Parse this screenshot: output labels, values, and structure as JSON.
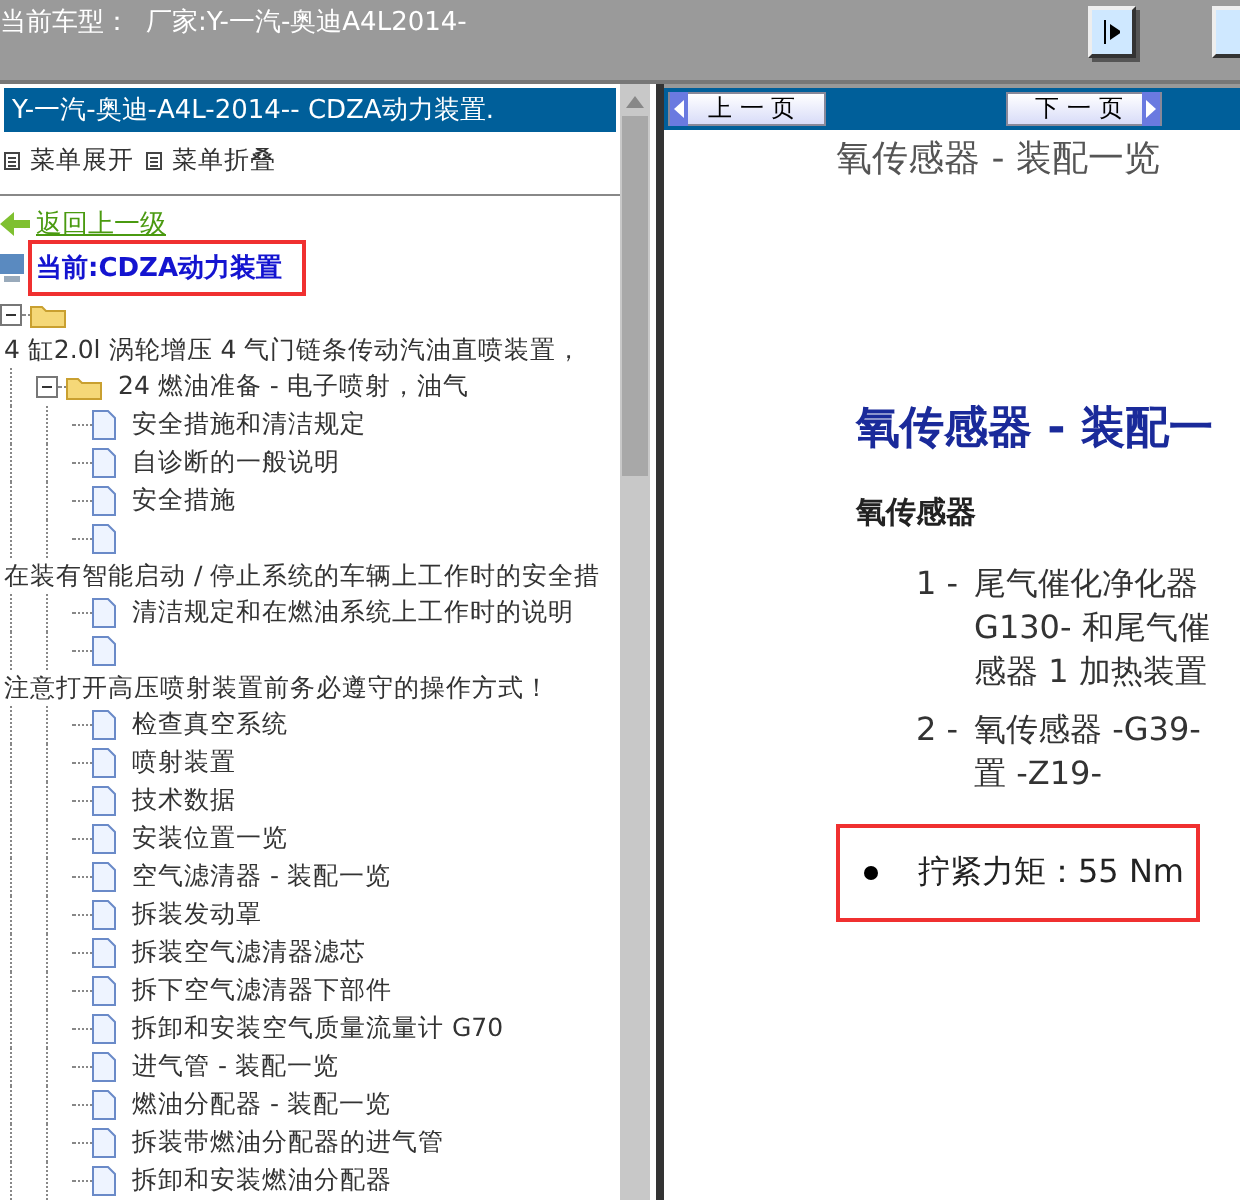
{
  "top_bar": {
    "label": "当前车型：",
    "vehicle": "厂家:Y-一汽-奥迪A4L2014-"
  },
  "left_pane": {
    "title": "Y-一汽-奥迪-A4L-2014-- CDZA动力装置.",
    "menu_actions": [
      "菜单展开",
      "菜单折叠"
    ],
    "back_link": "返回上一级",
    "current": "当前:CDZA动力装置",
    "tree": [
      {
        "kind": "folder",
        "expanded": true,
        "children": [
          {
            "kind": "note",
            "label": "4 缸2.0l 涡轮增压 4 气门链条传动汽油直喷装置，"
          },
          {
            "kind": "folder",
            "expanded": true,
            "label": "24 燃油准备 - 电子喷射，油气",
            "children": [
              {
                "kind": "doc",
                "label": "安全措施和清洁规定"
              },
              {
                "kind": "doc",
                "label": "自诊断的一般说明"
              },
              {
                "kind": "doc",
                "label": "安全措施"
              },
              {
                "kind": "doc"
              },
              {
                "kind": "note",
                "label": "在装有智能启动 / 停止系统的车辆上工作时的安全措"
              },
              {
                "kind": "doc",
                "label": "清洁规定和在燃油系统上工作时的说明"
              },
              {
                "kind": "doc"
              },
              {
                "kind": "note",
                "label": "注意打开高压喷射装置前务必遵守的操作方式！"
              },
              {
                "kind": "doc",
                "label": "检查真空系统"
              },
              {
                "kind": "doc",
                "label": "喷射装置"
              },
              {
                "kind": "doc",
                "label": "技术数据"
              },
              {
                "kind": "doc",
                "label": "安装位置一览"
              },
              {
                "kind": "doc",
                "label": "空气滤清器 - 装配一览"
              },
              {
                "kind": "doc",
                "label": "拆装发动罩"
              },
              {
                "kind": "doc",
                "label": "拆装空气滤清器滤芯"
              },
              {
                "kind": "doc",
                "label": "拆下空气滤清器下部件"
              },
              {
                "kind": "doc",
                "label": "拆卸和安装空气质量流量计 G70"
              },
              {
                "kind": "doc",
                "label": "进气管 - 装配一览"
              },
              {
                "kind": "doc",
                "label": "燃油分配器 - 装配一览"
              },
              {
                "kind": "doc",
                "label": "拆装带燃油分配器的进气管"
              },
              {
                "kind": "doc",
                "label": "拆卸和安装燃油分配器"
              }
            ]
          }
        ]
      }
    ]
  },
  "right_pane": {
    "prev_button": "上 一 页",
    "next_button": "下 一 页",
    "doc_title": "氧传感器  - 装配一览",
    "heading": "氧传感器 - 装配一",
    "subheading": "氧传感器",
    "items": [
      {
        "number": "1 -",
        "lines": [
          "尾气催化净化器",
          "G130- 和尾气催",
          "感器 1 加热装置"
        ]
      },
      {
        "number": "2 -",
        "lines": [
          "氧传感器 -G39-",
          "置 -Z19-"
        ]
      }
    ],
    "torque": "拧紧力矩：55 Nm"
  }
}
